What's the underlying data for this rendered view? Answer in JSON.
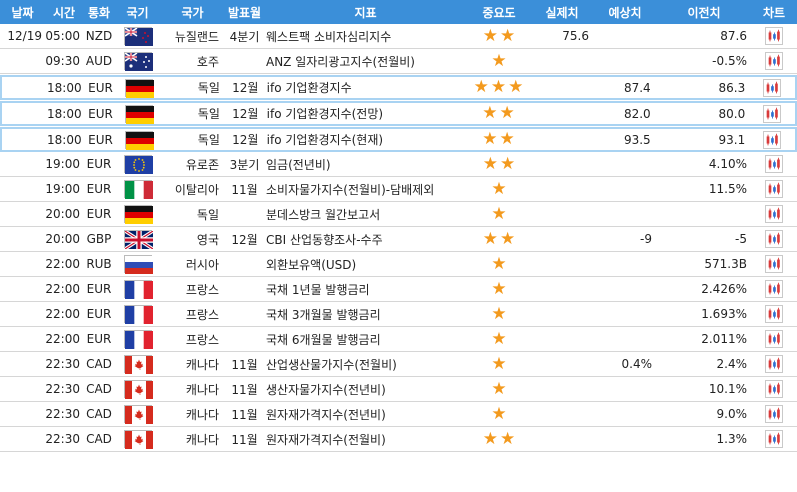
{
  "headers": {
    "date": "날짜",
    "time": "시간",
    "currency": "통화",
    "flag": "국기",
    "country": "국가",
    "period": "발표월",
    "indicator": "지표",
    "importance": "중요도",
    "actual": "실제치",
    "forecast": "예상치",
    "previous": "이전치",
    "chart": "차트"
  },
  "colors": {
    "header_bg": "#3b8fd9",
    "star": "#f39a1e",
    "highlight_border": "#a9d3f2"
  },
  "rows": [
    {
      "date": "12/19",
      "time": "05:00",
      "currency": "NZD",
      "flag": "nz",
      "country": "뉴질랜드",
      "period": "4분기",
      "indicator": "웨스트팩 소비자심리지수",
      "stars": 2,
      "actual": "75.6",
      "forecast": "",
      "previous": "87.6",
      "highlight": false
    },
    {
      "date": "",
      "time": "09:30",
      "currency": "AUD",
      "flag": "au",
      "country": "호주",
      "period": "",
      "indicator": "ANZ 일자리광고지수(전월비)",
      "stars": 1,
      "actual": "",
      "forecast": "",
      "previous": "-0.5%",
      "highlight": false
    },
    {
      "date": "",
      "time": "18:00",
      "currency": "EUR",
      "flag": "de",
      "country": "독일",
      "period": "12월",
      "indicator": "ifo 기업환경지수",
      "stars": 3,
      "actual": "",
      "forecast": "87.4",
      "previous": "86.3",
      "highlight": true
    },
    {
      "date": "",
      "time": "18:00",
      "currency": "EUR",
      "flag": "de",
      "country": "독일",
      "period": "12월",
      "indicator": "ifo 기업환경지수(전망)",
      "stars": 2,
      "actual": "",
      "forecast": "82.0",
      "previous": "80.0",
      "highlight": true
    },
    {
      "date": "",
      "time": "18:00",
      "currency": "EUR",
      "flag": "de",
      "country": "독일",
      "period": "12월",
      "indicator": "ifo 기업환경지수(현재)",
      "stars": 2,
      "actual": "",
      "forecast": "93.5",
      "previous": "93.1",
      "highlight": true
    },
    {
      "date": "",
      "time": "19:00",
      "currency": "EUR",
      "flag": "eu",
      "country": "유로존",
      "period": "3분기",
      "indicator": "임금(전년비)",
      "stars": 2,
      "actual": "",
      "forecast": "",
      "previous": "4.10%",
      "highlight": false
    },
    {
      "date": "",
      "time": "19:00",
      "currency": "EUR",
      "flag": "it",
      "country": "이탈리아",
      "period": "11월",
      "indicator": "소비자물가지수(전월비)-담배제외",
      "stars": 1,
      "actual": "",
      "forecast": "",
      "previous": "11.5%",
      "highlight": false
    },
    {
      "date": "",
      "time": "20:00",
      "currency": "EUR",
      "flag": "de",
      "country": "독일",
      "period": "",
      "indicator": "분데스방크 월간보고서",
      "stars": 1,
      "actual": "",
      "forecast": "",
      "previous": "",
      "highlight": false
    },
    {
      "date": "",
      "time": "20:00",
      "currency": "GBP",
      "flag": "gb",
      "country": "영국",
      "period": "12월",
      "indicator": "CBI 산업동향조사-수주",
      "stars": 2,
      "actual": "",
      "forecast": "-9",
      "previous": "-5",
      "highlight": false
    },
    {
      "date": "",
      "time": "22:00",
      "currency": "RUB",
      "flag": "ru",
      "country": "러시아",
      "period": "",
      "indicator": "외환보유액(USD)",
      "stars": 1,
      "actual": "",
      "forecast": "",
      "previous": "571.3B",
      "highlight": false
    },
    {
      "date": "",
      "time": "22:00",
      "currency": "EUR",
      "flag": "fr",
      "country": "프랑스",
      "period": "",
      "indicator": "국채 1년물 발행금리",
      "stars": 1,
      "actual": "",
      "forecast": "",
      "previous": "2.426%",
      "highlight": false
    },
    {
      "date": "",
      "time": "22:00",
      "currency": "EUR",
      "flag": "fr",
      "country": "프랑스",
      "period": "",
      "indicator": "국채 3개월물 발행금리",
      "stars": 1,
      "actual": "",
      "forecast": "",
      "previous": "1.693%",
      "highlight": false
    },
    {
      "date": "",
      "time": "22:00",
      "currency": "EUR",
      "flag": "fr",
      "country": "프랑스",
      "period": "",
      "indicator": "국채 6개월물 발행금리",
      "stars": 1,
      "actual": "",
      "forecast": "",
      "previous": "2.011%",
      "highlight": false
    },
    {
      "date": "",
      "time": "22:30",
      "currency": "CAD",
      "flag": "ca",
      "country": "캐나다",
      "period": "11월",
      "indicator": "산업생산물가지수(전월비)",
      "stars": 1,
      "actual": "",
      "forecast": "0.4%",
      "previous": "2.4%",
      "highlight": false
    },
    {
      "date": "",
      "time": "22:30",
      "currency": "CAD",
      "flag": "ca",
      "country": "캐나다",
      "period": "11월",
      "indicator": "생산자물가지수(전년비)",
      "stars": 1,
      "actual": "",
      "forecast": "",
      "previous": "10.1%",
      "highlight": false
    },
    {
      "date": "",
      "time": "22:30",
      "currency": "CAD",
      "flag": "ca",
      "country": "캐나다",
      "period": "11월",
      "indicator": "원자재가격지수(전년비)",
      "stars": 1,
      "actual": "",
      "forecast": "",
      "previous": "9.0%",
      "highlight": false
    },
    {
      "date": "",
      "time": "22:30",
      "currency": "CAD",
      "flag": "ca",
      "country": "캐나다",
      "period": "11월",
      "indicator": "원자재가격지수(전월비)",
      "stars": 2,
      "actual": "",
      "forecast": "",
      "previous": "1.3%",
      "highlight": false
    }
  ]
}
